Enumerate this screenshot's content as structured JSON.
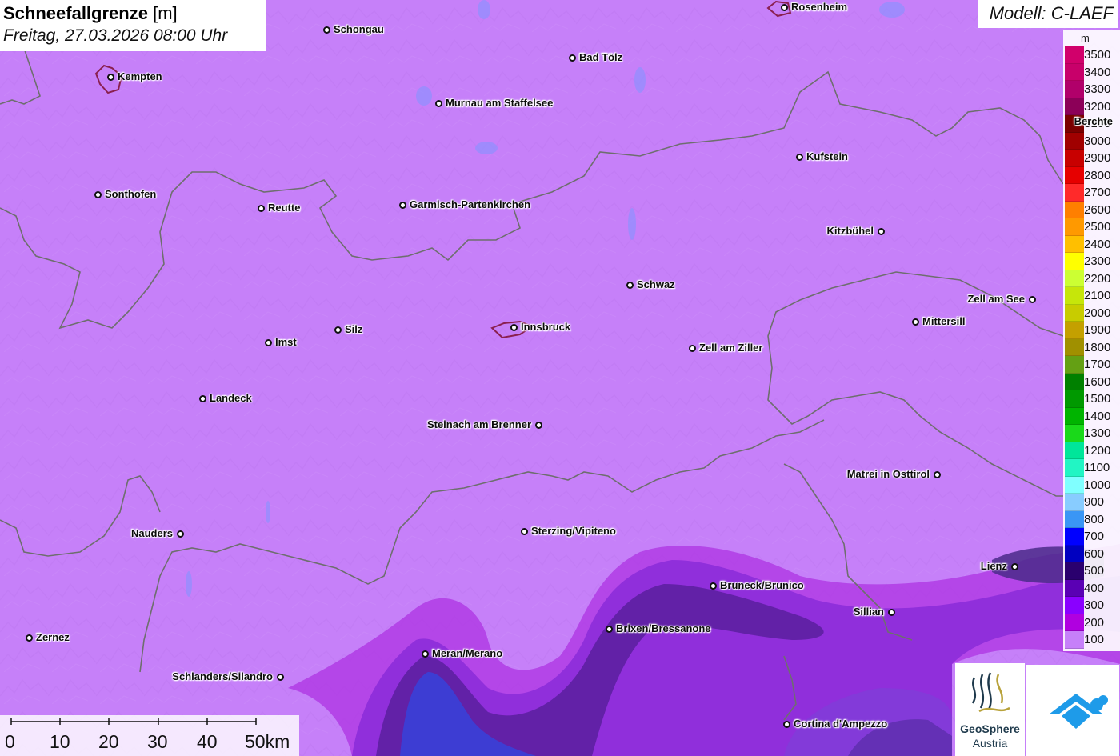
{
  "title": {
    "main": "Schneefallgrenze",
    "unit": "[m]",
    "date": "Freitag, 27.03.2026 08:00 Uhr"
  },
  "model": "Modell: C-LAEF",
  "legend": {
    "unit": "m",
    "items": [
      {
        "label": "3500",
        "color": "#d1006b"
      },
      {
        "label": "3400",
        "color": "#c8006a"
      },
      {
        "label": "3300",
        "color": "#b1006a"
      },
      {
        "label": "3200",
        "color": "#8c0058"
      },
      {
        "label": "3100",
        "color": "#7a0000"
      },
      {
        "label": "3000",
        "color": "#a00000"
      },
      {
        "label": "2900",
        "color": "#c80000"
      },
      {
        "label": "2800",
        "color": "#e60000"
      },
      {
        "label": "2700",
        "color": "#ff2a2a"
      },
      {
        "label": "2600",
        "color": "#ff7f00"
      },
      {
        "label": "2500",
        "color": "#ff9900"
      },
      {
        "label": "2400",
        "color": "#ffbf00"
      },
      {
        "label": "2300",
        "color": "#ffff00"
      },
      {
        "label": "2200",
        "color": "#ccff33"
      },
      {
        "label": "2100",
        "color": "#c6e60a"
      },
      {
        "label": "2000",
        "color": "#c8cc00"
      },
      {
        "label": "1900",
        "color": "#c4a000"
      },
      {
        "label": "1800",
        "color": "#a09000"
      },
      {
        "label": "1700",
        "color": "#64a014"
      },
      {
        "label": "1600",
        "color": "#008000"
      },
      {
        "label": "1500",
        "color": "#009900"
      },
      {
        "label": "1400",
        "color": "#00b400"
      },
      {
        "label": "1300",
        "color": "#1ad91a"
      },
      {
        "label": "1200",
        "color": "#00e69a"
      },
      {
        "label": "1100",
        "color": "#22f5c4"
      },
      {
        "label": "1000",
        "color": "#80ffff"
      },
      {
        "label": "900",
        "color": "#88ccff"
      },
      {
        "label": "800",
        "color": "#3a96f5"
      },
      {
        "label": "700",
        "color": "#0000ff"
      },
      {
        "label": "600",
        "color": "#0000c0"
      },
      {
        "label": "500",
        "color": "#2a006e"
      },
      {
        "label": "400",
        "color": "#5a00b4"
      },
      {
        "label": "300",
        "color": "#8a00ff"
      },
      {
        "label": "200",
        "color": "#b000e0"
      },
      {
        "label": "100",
        "color": "#c680f9"
      }
    ]
  },
  "cities": [
    {
      "name": "Rosenheim"
    },
    {
      "name": "Schongau"
    },
    {
      "name": "Bad Tölz"
    },
    {
      "name": "Kempten"
    },
    {
      "name": "Murnau am Staffelsee"
    },
    {
      "name": "Berchte"
    },
    {
      "name": "Kufstein"
    },
    {
      "name": "Sonthofen"
    },
    {
      "name": "Reutte"
    },
    {
      "name": "Garmisch-Partenkirchen"
    },
    {
      "name": "Kitzbühel"
    },
    {
      "name": "Schwaz"
    },
    {
      "name": "Zell am See"
    },
    {
      "name": "Mittersill"
    },
    {
      "name": "Silz"
    },
    {
      "name": "Innsbruck"
    },
    {
      "name": "Imst"
    },
    {
      "name": "Zell am Ziller"
    },
    {
      "name": "Landeck"
    },
    {
      "name": "Steinach am Brenner"
    },
    {
      "name": "Matrei in Osttirol"
    },
    {
      "name": "Nauders"
    },
    {
      "name": "Sterzing/Vipiteno"
    },
    {
      "name": "Lienz"
    },
    {
      "name": "Bruneck/Brunico"
    },
    {
      "name": "Sillian"
    },
    {
      "name": "Brixen/Bressanone"
    },
    {
      "name": "Zernez"
    },
    {
      "name": "Meran/Merano"
    },
    {
      "name": "Schlanders/Silandro"
    },
    {
      "name": "Cortina d'Ampezzo"
    }
  ],
  "scalebar": {
    "labels": [
      "0",
      "10",
      "20",
      "30",
      "40",
      "50km"
    ]
  },
  "logos": {
    "geosphere_line1": "GeoSphere",
    "geosphere_line2": "Austria"
  }
}
